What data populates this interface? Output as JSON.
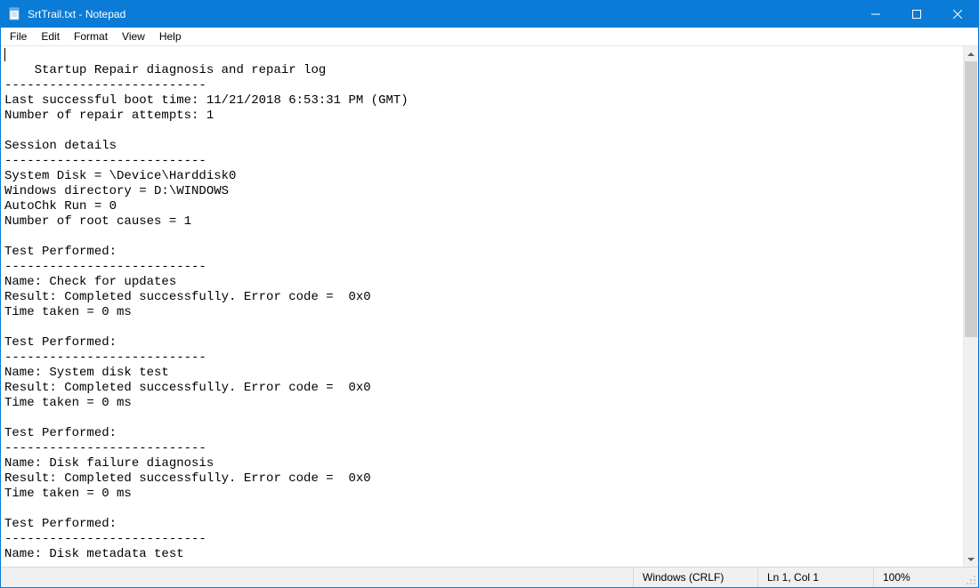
{
  "titlebar": {
    "title": "SrtTrail.txt - Notepad"
  },
  "menu": {
    "file": "File",
    "edit": "Edit",
    "format": "Format",
    "view": "View",
    "help": "Help"
  },
  "document": {
    "text": "Startup Repair diagnosis and repair log\n---------------------------\nLast successful boot time: 11/21/2018 6:53:31 PM (GMT)\nNumber of repair attempts: 1\n\nSession details\n---------------------------\nSystem Disk = \\Device\\Harddisk0\nWindows directory = D:\\WINDOWS\nAutoChk Run = 0\nNumber of root causes = 1\n\nTest Performed:\n---------------------------\nName: Check for updates\nResult: Completed successfully. Error code =  0x0\nTime taken = 0 ms\n\nTest Performed:\n---------------------------\nName: System disk test\nResult: Completed successfully. Error code =  0x0\nTime taken = 0 ms\n\nTest Performed:\n---------------------------\nName: Disk failure diagnosis\nResult: Completed successfully. Error code =  0x0\nTime taken = 0 ms\n\nTest Performed:\n---------------------------\nName: Disk metadata test"
  },
  "statusbar": {
    "line_ending": "Windows (CRLF)",
    "position": "Ln 1, Col 1",
    "zoom": "100%"
  }
}
